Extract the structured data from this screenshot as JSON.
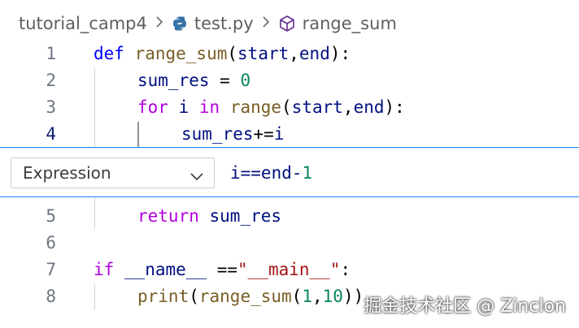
{
  "breadcrumb": {
    "folder": "tutorial_camp4",
    "file": "test.py",
    "symbol": "range_sum"
  },
  "code_lines": [
    {
      "number": "1",
      "tokens": [
        [
          "kw2",
          "def "
        ],
        [
          "fn",
          "range_sum"
        ],
        [
          "op",
          "("
        ],
        [
          "var",
          "start"
        ],
        [
          "op",
          ","
        ],
        [
          "var",
          "end"
        ],
        [
          "op",
          "):"
        ]
      ]
    },
    {
      "number": "2",
      "tokens": [
        [
          "var",
          "sum_res"
        ],
        [
          "op",
          " = "
        ],
        [
          "num",
          "0"
        ]
      ]
    },
    {
      "number": "3",
      "tokens": [
        [
          "kw",
          "for "
        ],
        [
          "var",
          "i "
        ],
        [
          "kw",
          "in "
        ],
        [
          "fn",
          "range"
        ],
        [
          "op",
          "("
        ],
        [
          "var",
          "start"
        ],
        [
          "op",
          ","
        ],
        [
          "var",
          "end"
        ],
        [
          "op",
          "):"
        ]
      ]
    },
    {
      "number": "4",
      "tokens": [
        [
          "var",
          "sum_res"
        ],
        [
          "op",
          "+="
        ],
        [
          "var",
          "i"
        ]
      ]
    },
    {
      "number": "5",
      "tokens": [
        [
          "kw",
          "return "
        ],
        [
          "var",
          "sum_res"
        ]
      ]
    },
    {
      "number": "6",
      "tokens": []
    },
    {
      "number": "7",
      "tokens": [
        [
          "kw",
          "if "
        ],
        [
          "var",
          "__name__"
        ],
        [
          "op",
          " =="
        ],
        [
          "str",
          "\"__main__\""
        ],
        [
          "op",
          ":"
        ]
      ]
    },
    {
      "number": "8",
      "tokens": [
        [
          "fn",
          "print"
        ],
        [
          "op",
          "("
        ],
        [
          "fn",
          "range_sum"
        ],
        [
          "op",
          "("
        ],
        [
          "num",
          "1"
        ],
        [
          "op",
          ","
        ],
        [
          "num",
          "10"
        ],
        [
          "op",
          "))"
        ]
      ]
    }
  ],
  "breakpoint_editor": {
    "type_selected": "Expression",
    "condition_value": "i==end-1"
  },
  "watermark": "掘金技术社区 @ Zinclon",
  "colors": {
    "keyword_control": "#af00db",
    "keyword_def": "#0000ff",
    "function": "#795e26",
    "variable": "#001080",
    "number": "#098658",
    "string": "#a31515",
    "widget_border": "#1a85ff"
  }
}
